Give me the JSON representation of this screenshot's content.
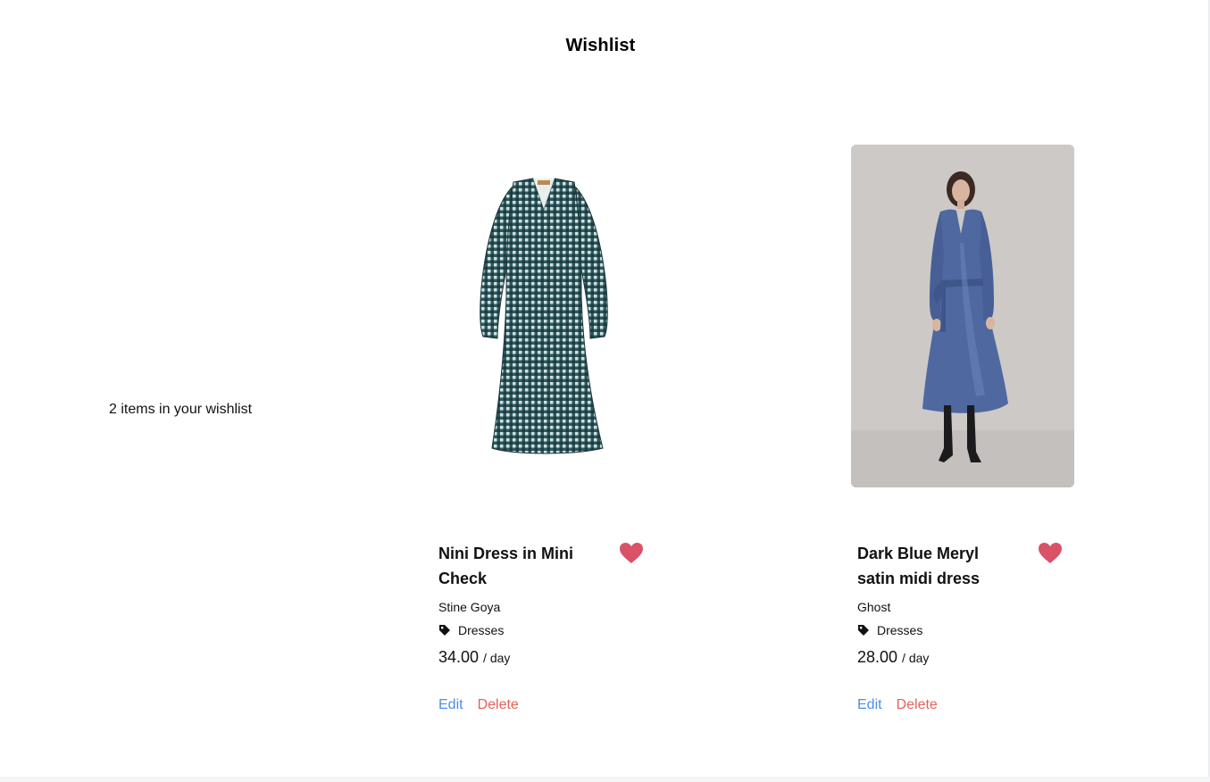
{
  "page": {
    "title": "Wishlist",
    "count_text": "2 items in your wishlist"
  },
  "theme": {
    "heart_color": "#d95268",
    "edit_color": "#4a8ee6",
    "delete_color": "#e5605a"
  },
  "items": [
    {
      "name": "Nini Dress in Mini Check",
      "brand": "Stine Goya",
      "category": "Dresses",
      "category_icon": "tag-icon",
      "price": "34.00",
      "price_unit": "/ day",
      "favorite_icon": "heart-icon",
      "edit_label": "Edit",
      "delete_label": "Delete"
    },
    {
      "name": "Dark Blue Meryl satin midi dress",
      "brand": "Ghost",
      "category": "Dresses",
      "category_icon": "tag-icon",
      "price": "28.00",
      "price_unit": "/ day",
      "favorite_icon": "heart-icon",
      "edit_label": "Edit",
      "delete_label": "Delete"
    }
  ]
}
